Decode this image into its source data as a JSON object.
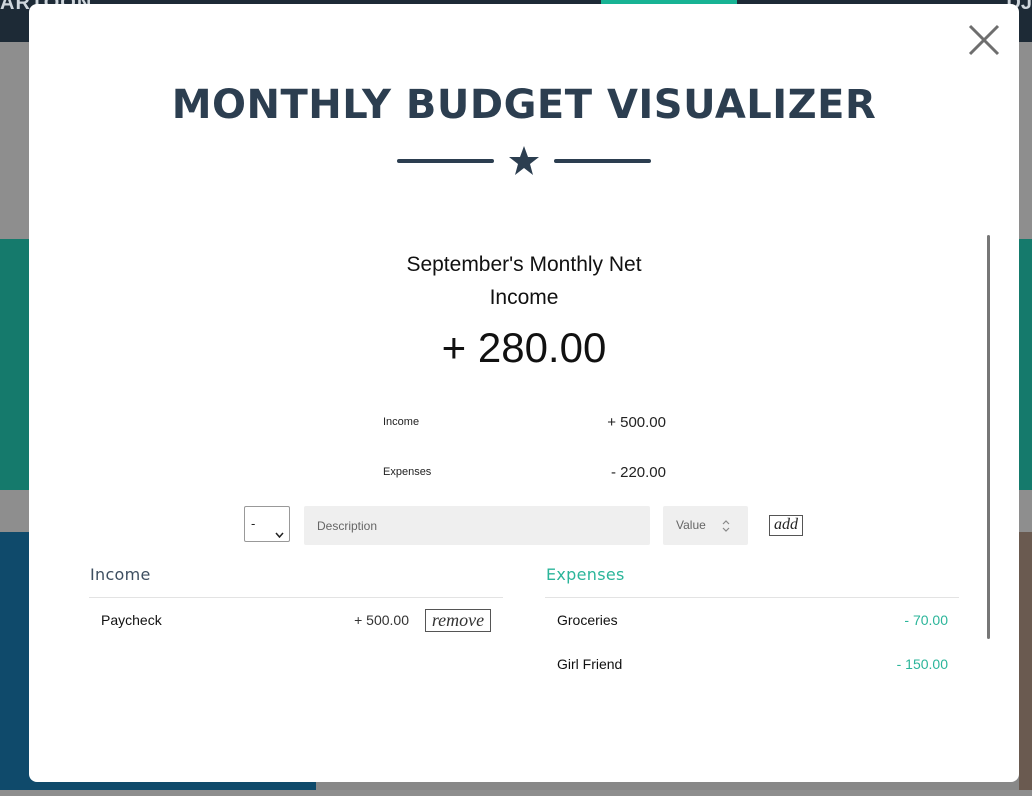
{
  "background": {
    "nav_left_text": "ARTOON",
    "nav_right_text": "DJ"
  },
  "modal": {
    "title": "MONTHLY BUDGET VISUALIZER",
    "colors": {
      "heading": "#2c3e50",
      "accent": "#2bb59a"
    }
  },
  "summary": {
    "net_label_line1": "September's Monthly Net",
    "net_label_line2": "Income",
    "net_value": "+ 280.00",
    "income_label": "Income",
    "income_value": "+ 500.00",
    "expenses_label": "Expenses",
    "expenses_value": "- 220.00"
  },
  "add_form": {
    "type_selected": "-",
    "description_placeholder": "Description",
    "value_placeholder": "Value",
    "add_label": "add"
  },
  "income_list": {
    "title": "Income",
    "items": [
      {
        "description": "Paycheck",
        "value": "+ 500.00",
        "remove_label": "remove"
      }
    ]
  },
  "expenses_list": {
    "title": "Expenses",
    "items": [
      {
        "description": "Groceries",
        "value": "- 70.00"
      },
      {
        "description": "Girl Friend",
        "value": "- 150.00"
      }
    ]
  },
  "icons": {
    "close": "close-icon",
    "star": "star-icon",
    "select_chevron": "chevron-down-icon",
    "spinner": "spinner-arrows-icon"
  }
}
